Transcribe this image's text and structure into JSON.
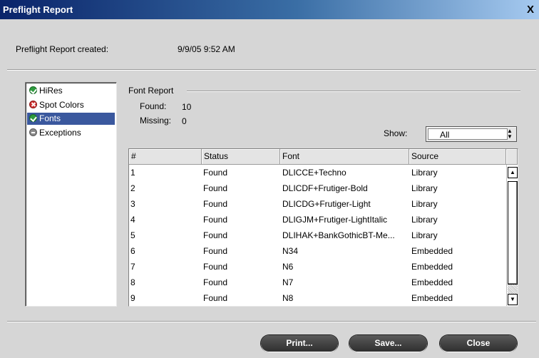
{
  "window": {
    "title": "Preflight Report",
    "close_glyph": "X"
  },
  "summary": {
    "created_label": "Preflight Report created:",
    "created_value": "9/9/05 9:52 AM"
  },
  "sidebar": {
    "items": [
      {
        "label": "HiRes",
        "status": "ok",
        "icon": "check-circle-icon"
      },
      {
        "label": "Spot Colors",
        "status": "error",
        "icon": "x-circle-icon"
      },
      {
        "label": "Fonts",
        "status": "ok",
        "icon": "check-circle-icon",
        "selected": true
      },
      {
        "label": "Exceptions",
        "status": "neutral",
        "icon": "minus-circle-icon"
      }
    ]
  },
  "font_report": {
    "title": "Font Report",
    "found_label": "Found:",
    "found_value": "10",
    "missing_label": "Missing:",
    "missing_value": "0",
    "show_label": "Show:",
    "show_value": "All"
  },
  "table": {
    "columns": [
      "#",
      "Status",
      "Font",
      "Source"
    ],
    "rows": [
      [
        "1",
        "Found",
        "DLICCE+Techno",
        "Library"
      ],
      [
        "2",
        "Found",
        "DLICDF+Frutiger-Bold",
        "Library"
      ],
      [
        "3",
        "Found",
        "DLICDG+Frutiger-Light",
        "Library"
      ],
      [
        "4",
        "Found",
        "DLIGJM+Frutiger-LightItalic",
        "Library"
      ],
      [
        "5",
        "Found",
        "DLIHAK+BankGothicBT-Me...",
        "Library"
      ],
      [
        "6",
        "Found",
        "N34",
        "Embedded"
      ],
      [
        "7",
        "Found",
        "N6",
        "Embedded"
      ],
      [
        "8",
        "Found",
        "N7",
        "Embedded"
      ],
      [
        "9",
        "Found",
        "N8",
        "Embedded"
      ]
    ]
  },
  "buttons": {
    "print": "Print...",
    "save": "Save...",
    "close": "Close"
  },
  "colors": {
    "selection": "#3a589e",
    "ok": "#2e9b3e",
    "error": "#d03030",
    "button": "#3a3a3a"
  }
}
